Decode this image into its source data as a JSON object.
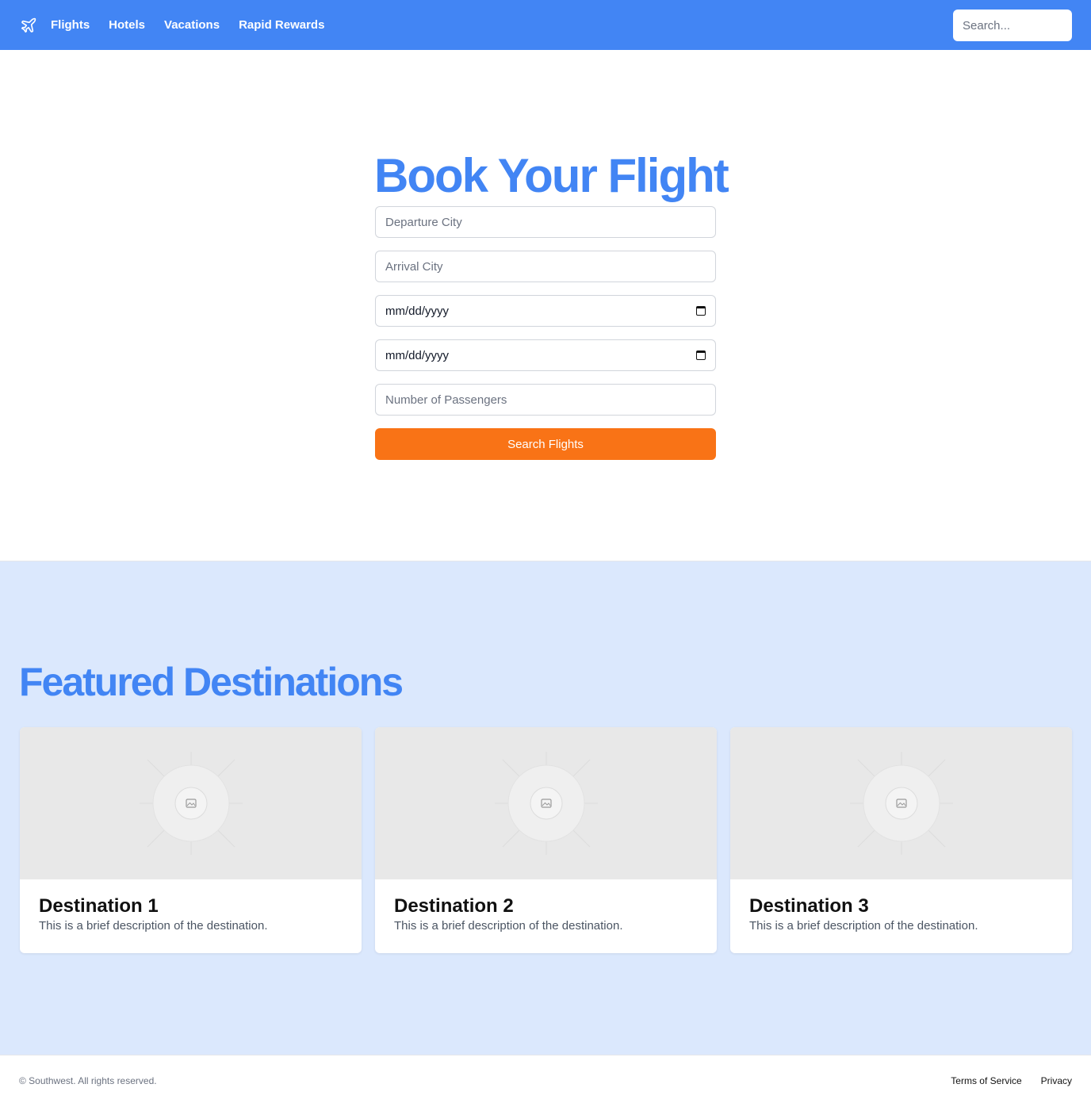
{
  "nav": {
    "logo_icon": "airplane-icon",
    "links": [
      "Flights",
      "Hotels",
      "Vacations",
      "Rapid Rewards"
    ],
    "search_placeholder": "Search..."
  },
  "hero": {
    "title": "Book Your Flight",
    "departure_placeholder": "Departure City",
    "arrival_placeholder": "Arrival City",
    "depart_date": "mm/dd/yyyy",
    "return_date": "mm/dd/yyyy",
    "passengers_placeholder": "Number of Passengers",
    "search_button": "Search Flights",
    "button_color": "#f97316"
  },
  "featured": {
    "title": "Featured Destinations",
    "cards": [
      {
        "title": "Destination 1",
        "desc": "This is a brief description of the destination.",
        "image_icon": "image-placeholder-icon"
      },
      {
        "title": "Destination 2",
        "desc": "This is a brief description of the destination.",
        "image_icon": "image-placeholder-icon"
      },
      {
        "title": "Destination 3",
        "desc": "This is a brief description of the destination.",
        "image_icon": "image-placeholder-icon"
      }
    ]
  },
  "footer": {
    "copyright": "© Southwest. All rights reserved.",
    "links": [
      "Terms of Service",
      "Privacy"
    ]
  },
  "colors": {
    "brand": "#4285f4",
    "accent": "#f97316",
    "featured_bg": "#dbe8fd"
  }
}
